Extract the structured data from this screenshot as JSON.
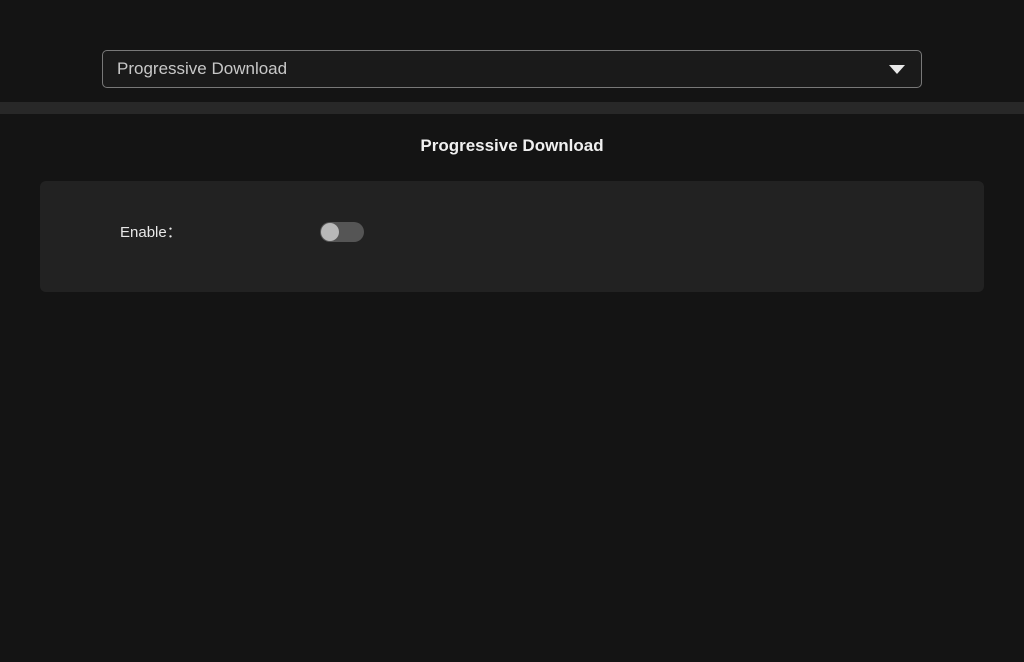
{
  "dropdown": {
    "selected": "Progressive Download"
  },
  "page": {
    "title": "Progressive Download"
  },
  "settings": {
    "enable_label": "Enable：",
    "enable_value": false
  }
}
